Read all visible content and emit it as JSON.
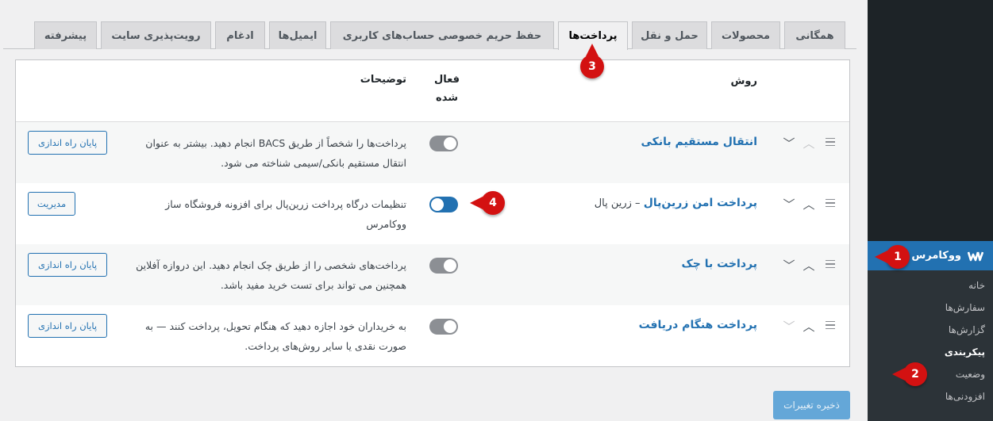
{
  "tabs": [
    {
      "label": "همگانی",
      "active": false
    },
    {
      "label": "محصولات",
      "active": false
    },
    {
      "label": "حمل و نقل",
      "active": false
    },
    {
      "label": "پرداخت‌ها",
      "active": true
    },
    {
      "label": "حفظ حریم خصوصی حساب‌های کاربری",
      "active": false
    },
    {
      "label": "ایمیل‌ها",
      "active": false
    },
    {
      "label": "ادغام",
      "active": false
    },
    {
      "label": "رویت‌پذیری سایت",
      "active": false
    },
    {
      "label": "پیشرفته",
      "active": false
    }
  ],
  "table": {
    "headers": {
      "method": "روش",
      "enabled_line1": "فعال",
      "enabled_line2": "شده",
      "description": "توضیحات"
    },
    "rows": [
      {
        "method": "انتقال مستقیم بانکی",
        "method_suffix": "",
        "enabled": false,
        "description": "پرداخت‌ها را شخصاً از طریق BACS انجام دهید. بیشتر به عنوان انتقال مستقیم بانکی/سیمی شناخته می شود.",
        "action": "پایان راه اندازی"
      },
      {
        "method": "پرداخت امن زرین‌پال",
        "method_suffix": " – زرین پال",
        "enabled": true,
        "description": "تنظیمات درگاه پرداخت زرین‌پال برای افزونه فروشگاه ساز ووکامرس",
        "action": "مدیریت"
      },
      {
        "method": "پرداخت با چک",
        "method_suffix": "",
        "enabled": false,
        "description": "پرداخت‌های شخصی را از طریق چک انجام دهید. این دروازه آفلاین همچنین می تواند برای تست خرید مفید باشد.",
        "action": "پایان راه اندازی"
      },
      {
        "method": "پرداخت هنگام دریافت",
        "method_suffix": "",
        "enabled": false,
        "description": "به خریداران خود اجازه دهید که هنگام تحویل، پرداخت کنند — به صورت نقدی یا سایر روش‌های پرداخت.",
        "action": "پایان راه اندازی"
      }
    ]
  },
  "save_button": "ذخیره تغییرات",
  "sidebar": {
    "active_menu": "ووکامرس",
    "submenu": [
      {
        "label": "خانه",
        "current": false
      },
      {
        "label": "سفارش‌ها",
        "current": false
      },
      {
        "label": "گزارش‌ها",
        "current": false
      },
      {
        "label": "پیکربندی",
        "current": true
      },
      {
        "label": "وضعیت",
        "current": false
      },
      {
        "label": "افزودنی‌ها",
        "current": false
      }
    ]
  },
  "markers": [
    "1",
    "2",
    "3",
    "4"
  ],
  "colors": {
    "accent": "#2271b1",
    "marker": "#d31111",
    "sidebar": "#1d2327"
  },
  "icons": {
    "woocommerce": "woocommerce-icon",
    "drag": "drag-handle-icon",
    "up": "chevron-up-icon",
    "down": "chevron-down-icon"
  }
}
